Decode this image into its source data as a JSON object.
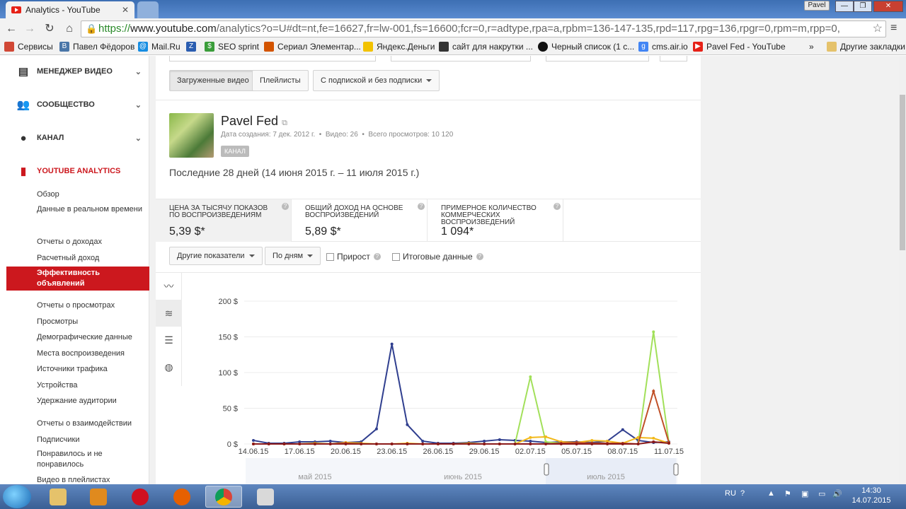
{
  "browser": {
    "tab_title": "Analytics - YouTube",
    "tab_close": "✕",
    "profile": "Pavel",
    "url_scheme": "https://",
    "url_host": "www.youtube.com",
    "url_rest": "/analytics?o=U#dt=nt,fe=16627,fr=lw-001,fs=16600;fcr=0,r=adtype,rpa=a,rpbm=136-147-135,rpd=117,rpg=136,rpgr=0,rpm=m,rpp=0,",
    "bookmarks": [
      {
        "label": "Сервисы",
        "icon": "apps-icon",
        "color": "#d14836"
      },
      {
        "label": "Павел Фёдоров",
        "icon": "vk-icon",
        "color": "#4a76a8"
      },
      {
        "label": "Mail.Ru",
        "icon": "mailru-icon",
        "color": "#168de2"
      },
      {
        "label": "",
        "icon": "translate-icon",
        "color": "#2a5db0"
      },
      {
        "label": "SEO sprint",
        "icon": "seosprint-icon",
        "color": "#3a9d3a"
      },
      {
        "label": "Сериал Элементар...",
        "icon": "serial-icon",
        "color": "#d35400"
      },
      {
        "label": "Яндекс.Деньги",
        "icon": "yandex-money-icon",
        "color": "#f2c200"
      },
      {
        "label": "сайт для накрутки ...",
        "icon": "site-icon",
        "color": "#333333"
      },
      {
        "label": "Черный список (1 с...",
        "icon": "blacklist-icon",
        "color": "#111111"
      },
      {
        "label": "cms.air.io",
        "icon": "google-icon",
        "color": "#4285f4"
      },
      {
        "label": "Pavel Fed - YouTube",
        "icon": "youtube-icon",
        "color": "#e62117"
      }
    ],
    "bookmarks_overflow": "»",
    "other_bookmarks": "Другие закладки"
  },
  "sidebar": {
    "sections": [
      {
        "label": "МЕНЕДЖЕР ВИДЕО",
        "icon": "video-manager-icon"
      },
      {
        "label": "СООБЩЕСТВО",
        "icon": "community-icon"
      },
      {
        "label": "КАНАЛ",
        "icon": "channel-icon"
      },
      {
        "label": "YOUTUBE ANALYTICS",
        "icon": "analytics-icon"
      }
    ],
    "items": {
      "overview": "Обзор",
      "realtime": "Данные в реальном времени",
      "revenue_reports": "Отчеты о доходах",
      "estimated_revenue": "Расчетный доход",
      "ad_performance": "Эффективность объявлений",
      "view_reports": "Отчеты о просмотрах",
      "views": "Просмотры",
      "demographics": "Демографические данные",
      "playback_locations": "Места воспроизведения",
      "traffic_sources": "Источники трафика",
      "devices": "Устройства",
      "retention": "Удержание аудитории",
      "engagement_reports": "Отчеты о взаимодействии",
      "subscribers": "Подписчики",
      "likes": "Понравилось и не понравилось",
      "playlists": "Видео в плейлистах"
    }
  },
  "filters": {
    "uploaded": "Загруженные видео",
    "playlists": "Плейлисты",
    "subscription": "С подпиской и без подписки"
  },
  "channel": {
    "name": "Pavel Fed",
    "created": "Дата создания: 7 дек. 2012 г.",
    "videos": "Видео: 26",
    "views": "Всего просмотров: 10 120",
    "badge": "КАНАЛ",
    "range": "Последние 28 дней (14 июня 2015 г. – 11 июля 2015 г.)"
  },
  "metrics": [
    {
      "label": "Цена за тысячу показов по воспроизведениям",
      "value": "5,39 $*"
    },
    {
      "label": "Общий доход на основе воспроизведений",
      "value": "5,89 $*"
    },
    {
      "label": "Примерное количество коммерческих воспроизведений",
      "value": "1 094*"
    }
  ],
  "controls": {
    "other_metrics": "Другие показатели",
    "by_days": "По дням",
    "growth": "Прирост",
    "totals": "Итоговые данные",
    "help": "?"
  },
  "chart_data": {
    "type": "line",
    "ylim": [
      0,
      200
    ],
    "y_ticks": [
      "0 $",
      "50 $",
      "100 $",
      "150 $",
      "200 $"
    ],
    "y_tick_values": [
      0,
      50,
      100,
      150,
      200
    ],
    "x_tick_labels": [
      "14.06.15",
      "17.06.15",
      "20.06.15",
      "23.06.15",
      "26.06.15",
      "29.06.15",
      "02.07.15",
      "05.07.15",
      "08.07.15",
      "11.07.15"
    ],
    "x": [
      "14.06",
      "15.06",
      "16.06",
      "17.06",
      "18.06",
      "19.06",
      "20.06",
      "21.06",
      "22.06",
      "23.06",
      "24.06",
      "25.06",
      "26.06",
      "27.06",
      "28.06",
      "29.06",
      "30.06",
      "01.07",
      "02.07",
      "03.07",
      "04.07",
      "05.07",
      "06.07",
      "07.07",
      "08.07",
      "09.07",
      "10.07",
      "11.07"
    ],
    "series": [
      {
        "color": "#303f8f",
        "values": [
          5,
          1,
          1,
          3,
          3,
          4,
          2,
          3,
          21,
          140,
          27,
          4,
          1,
          1,
          2,
          4,
          6,
          5,
          4,
          2,
          3,
          3,
          2,
          4,
          20,
          5,
          2,
          3
        ]
      },
      {
        "color": "#a2e05a",
        "values": [
          0,
          0,
          0,
          0,
          0,
          0,
          0,
          0,
          0,
          0,
          0,
          0,
          0,
          0,
          0,
          0,
          0,
          0,
          94,
          3,
          1,
          1,
          0,
          0,
          0,
          0,
          157,
          2
        ]
      },
      {
        "color": "#f2b91b",
        "values": [
          0,
          0,
          0,
          0,
          1,
          0,
          2,
          1,
          0,
          0,
          1,
          0,
          0,
          0,
          1,
          0,
          0,
          0,
          9,
          10,
          3,
          2,
          5,
          4,
          1,
          9,
          8,
          1
        ]
      },
      {
        "color": "#c05028",
        "values": [
          0,
          0,
          0,
          0,
          0,
          0,
          1,
          0,
          0,
          0,
          0,
          0,
          0,
          0,
          0,
          0,
          0,
          0,
          0,
          0,
          1,
          2,
          1,
          1,
          1,
          0,
          74,
          2
        ]
      },
      {
        "color": "#8b1a1a",
        "values": [
          0,
          0,
          0,
          0,
          0,
          0,
          0,
          0,
          0,
          0,
          0,
          0,
          0,
          0,
          0,
          0,
          0,
          0,
          0,
          0,
          0,
          0,
          0,
          0,
          0,
          0,
          3,
          1
        ]
      }
    ],
    "navigator_labels": [
      "май 2015",
      "июнь 2015",
      "июль 2015"
    ]
  },
  "taskbar": {
    "lang": "RU",
    "time": "14:30",
    "date": "14.07.2015"
  }
}
